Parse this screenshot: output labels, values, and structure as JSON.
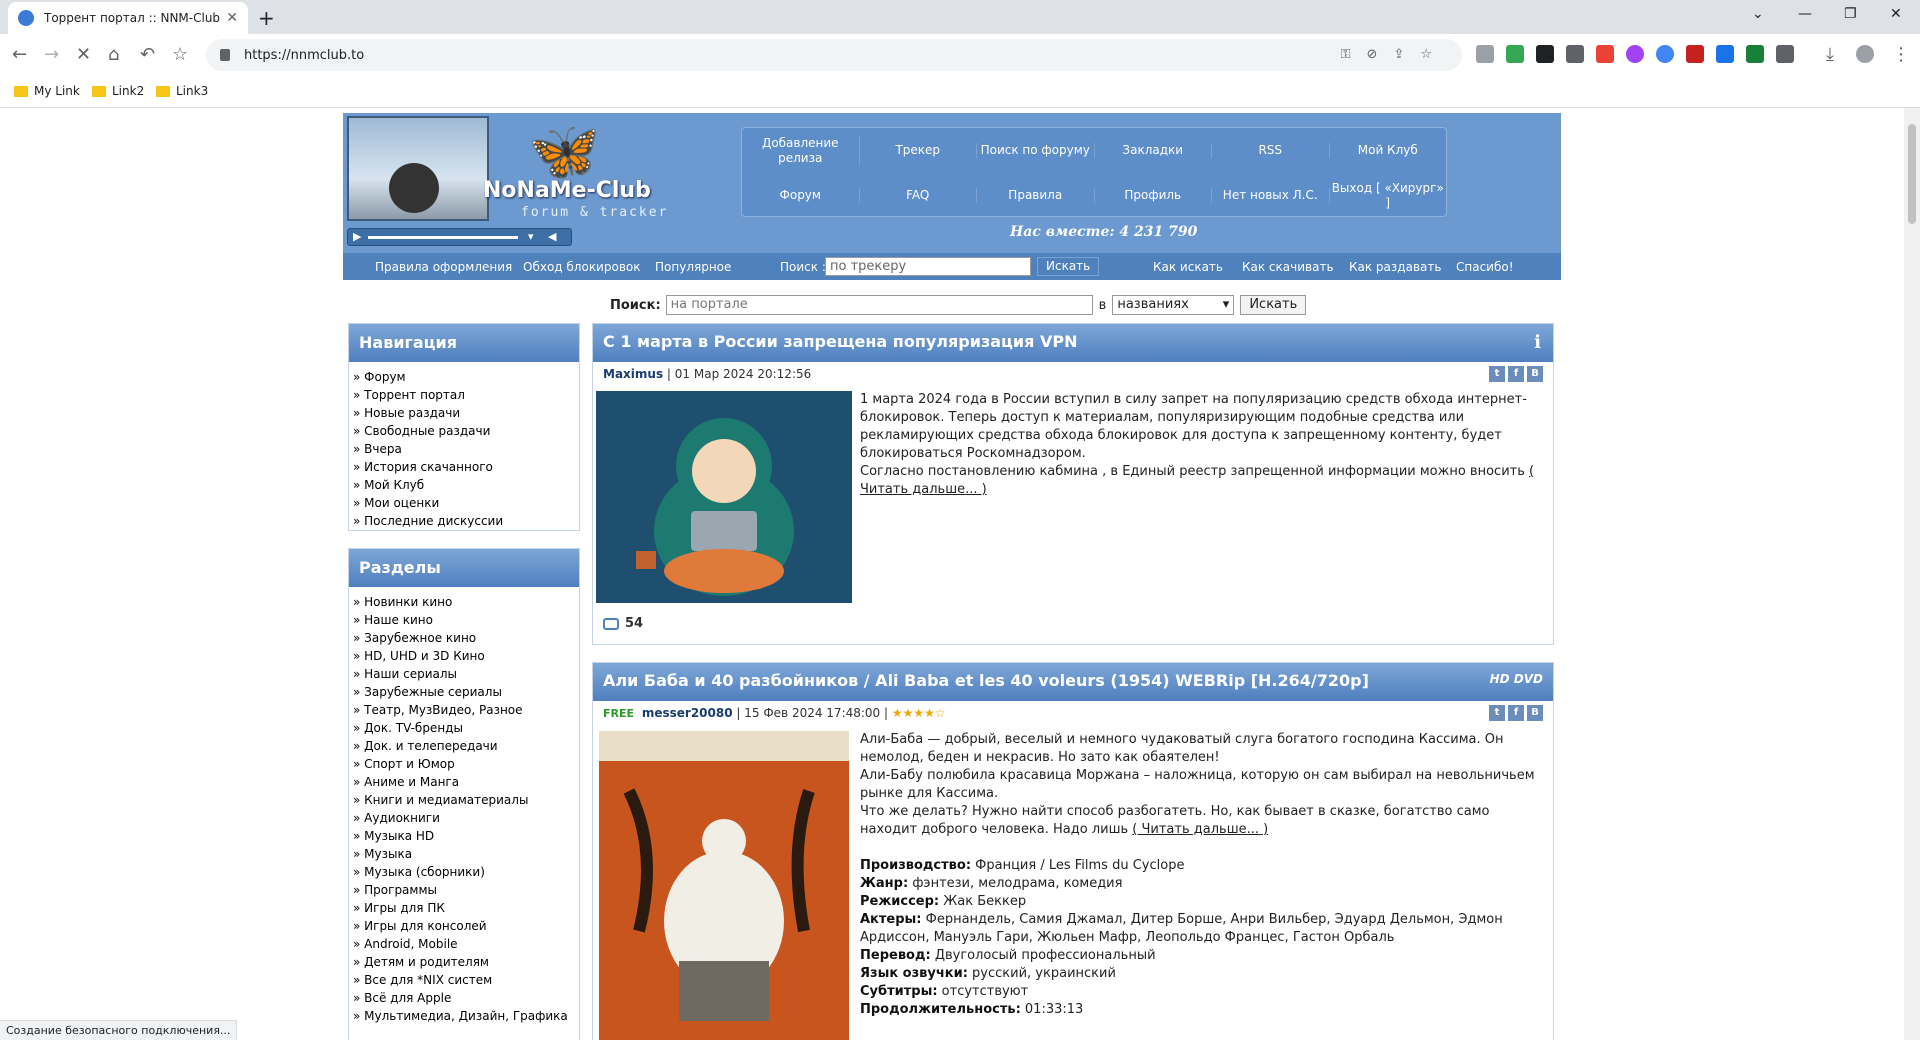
{
  "browser": {
    "tab_title": "Торрент портал :: NNM-Club",
    "url": "https://nnmclub.to",
    "bookmarks": [
      "My Link",
      "Link2",
      "Link3"
    ],
    "status": "Создание безопасного подключения..."
  },
  "header": {
    "logo_text": "NoNaMe-Club",
    "logo_sub": "forum & tracker",
    "together": "Нас вместе: 4 231 790",
    "menu_row1": [
      "Добавление релиза",
      "Трекер",
      "Поиск по форуму",
      "Закладки",
      "RSS",
      "Мой Клуб"
    ],
    "menu_row2": [
      "Форум",
      "FAQ",
      "Правила",
      "Профиль",
      "Нет новых Л.С.",
      "Выход [ «Хирург» ]"
    ]
  },
  "subbar": {
    "links_left": [
      "Правила оформления",
      "Обход блокировок",
      "Популярное"
    ],
    "search_label": "Поиск :",
    "search_placeholder": "по трекеру",
    "search_button": "Искать",
    "links_right": [
      "Как искать",
      "Как скачивать",
      "Как раздавать",
      "Спасибо!"
    ]
  },
  "portal_search": {
    "label": "Поиск:",
    "placeholder": "на портале",
    "in_label": "в",
    "select_value": "названиях",
    "button": "Искать"
  },
  "nav": {
    "title": "Навигация",
    "items": [
      "» Форум",
      "» Торрент портал",
      "» Новые раздачи",
      "» Свободные раздачи",
      "» Вчера",
      "» История скачанного",
      "» Мой Клуб",
      "» Мои оценки",
      "» Последние дискуссии"
    ]
  },
  "sections": {
    "title": "Разделы",
    "items": [
      "» Новинки кино",
      "» Наше кино",
      "» Зарубежное кино",
      "» HD, UHD и 3D Кино",
      "» Наши сериалы",
      "» Зарубежные сериалы",
      "» Театр, МузВидео, Разное",
      "» Док. TV-бренды",
      "» Док. и телепередачи",
      "» Спорт и Юмор",
      "» Аниме и Манга",
      "» Книги и медиаматериалы",
      "» Аудиокниги",
      "» Музыка HD",
      "» Музыка",
      "» Музыка (сборники)",
      "» Программы",
      "» Игры для ПК",
      "» Игры для консолей",
      "» Android, Mobile",
      "» Детям и родителям",
      "» Все для *NIX систем",
      "» Всё для Apple",
      "» Мультимедиа, Дизайн, Графика"
    ]
  },
  "post1": {
    "title": "С 1 марта в России запрещена популяризация VPN",
    "author": "Maximus",
    "date": "| 01 Мар 2024 20:12:56",
    "text": "1 марта 2024 года в России вступил в силу запрет на популяризацию средств обхода интернет-блокировок. Теперь доступ к материалам, популяризирующим подобные средства или рекламирующих средства обхода блокировок для доступа к запрещенному контенту, будет блокироваться Роскомнадзором.",
    "text2": "Согласно постановлению кабмина , в Единый реестр запрещенной информации можно вносить",
    "readmore": "( Читать дальше... )",
    "comments": "54"
  },
  "post2": {
    "title": "Али Баба и 40 разбойников / Ali Baba et les 40 voleurs (1954) WEBRip [H.264/720p]",
    "badge": "HD DVD",
    "free": "FREE",
    "author": "messer20080",
    "date": "| 15 Фев 2024 17:48:00 |",
    "stars": "★★★★☆",
    "p1": "Али-Баба — добрый, веселый и немного чудаковатый слуга богатого господина Кассима. Он немолод, беден и некрасив. Но зато как обаятелен!",
    "p2": "Али-Бабу полюбила красавица Моржана – наложница, которую он сам выбирал на невольничьем рынке для Кассима.",
    "p3": "Что же делать? Нужно найти способ разбогатеть. Но, как бывает в сказке, богатство само находит доброго человека. Надо лишь",
    "readmore": "( Читать дальше... )",
    "details": [
      {
        "k": "Производство:",
        "v": " Франция / Les Films du Cyclope"
      },
      {
        "k": "Жанр:",
        "v": " фэнтези, мелодрама, комедия"
      },
      {
        "k": "Режиссер:",
        "v": " Жак Беккер"
      },
      {
        "k": "Актеры:",
        "v": " Фернандель, Самия Джамал, Дитер Борше, Анри Вильбер, Эдуард Дельмон, Эдмон Ардиссон, Мануэль Гари, Жюльен Мафр, Леопольдо Францес, Гастон Орбаль"
      },
      {
        "k": "Перевод:",
        "v": " Двуголосый профессиональный"
      },
      {
        "k": "Язык озвучки:",
        "v": " русский, украинский"
      },
      {
        "k": "Субтитры:",
        "v": " отсутствуют"
      },
      {
        "k": "Продолжительность:",
        "v": " 01:33:13"
      }
    ]
  }
}
